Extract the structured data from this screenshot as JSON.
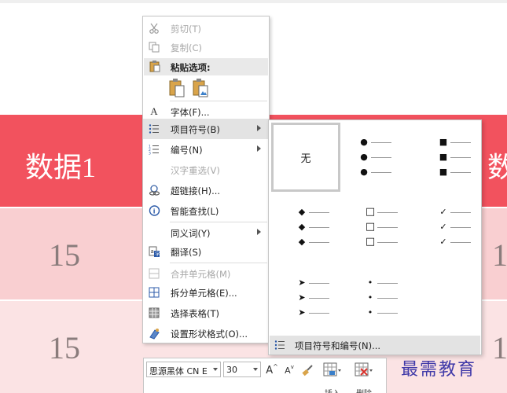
{
  "table": {
    "header": {
      "cell_left": "数据1",
      "cell_right": "数"
    },
    "rows": [
      {
        "cell_left": "15",
        "cell_right": "1"
      },
      {
        "cell_left": "15",
        "cell_right": "1"
      }
    ]
  },
  "context_menu": {
    "cut": "剪切(T)",
    "copy": "复制(C)",
    "paste_options": "粘贴选项:",
    "font": "字体(F)...",
    "bullets": "项目符号(B)",
    "numbering": "编号(N)",
    "hanzi_reselect": "汉字重选(V)",
    "hyperlink": "超链接(H)...",
    "smart_lookup": "智能查找(L)",
    "synonyms": "同义词(Y)",
    "translate": "翻译(S)",
    "merge_cells": "合并单元格(M)",
    "split_cells": "拆分单元格(E)...",
    "select_table": "选择表格(T)",
    "format_shape": "设置形状格式(O)..."
  },
  "bullet_submenu": {
    "none_label": "无",
    "footer": "项目符号和编号(N)...",
    "library": [
      {
        "name": "none",
        "symbol": ""
      },
      {
        "name": "filled-round-bullets",
        "symbol": "●"
      },
      {
        "name": "filled-square-bullets",
        "symbol": "■"
      },
      {
        "name": "diamond-bullets",
        "symbol": "◆"
      },
      {
        "name": "hollow-square-bullets",
        "symbol": "□"
      },
      {
        "name": "checkmark-bullets",
        "symbol": "✓"
      },
      {
        "name": "arrow-bullets",
        "symbol": "➤"
      },
      {
        "name": "small-dot-bullets",
        "symbol": "•"
      }
    ]
  },
  "mini_toolbar": {
    "font_name": "思源黑体 CN E",
    "font_size": "30",
    "increase_font": "A",
    "decrease_font": "A",
    "insert_label": "插入",
    "delete_label": "删除"
  },
  "watermark": {
    "text": "最需教育"
  },
  "colors": {
    "header_row": "#f2525e",
    "row1": "#f9cfd1",
    "row2": "#fbe3e4",
    "watermark": "#3f39a8",
    "menu_hover": "#e3e3e3"
  }
}
